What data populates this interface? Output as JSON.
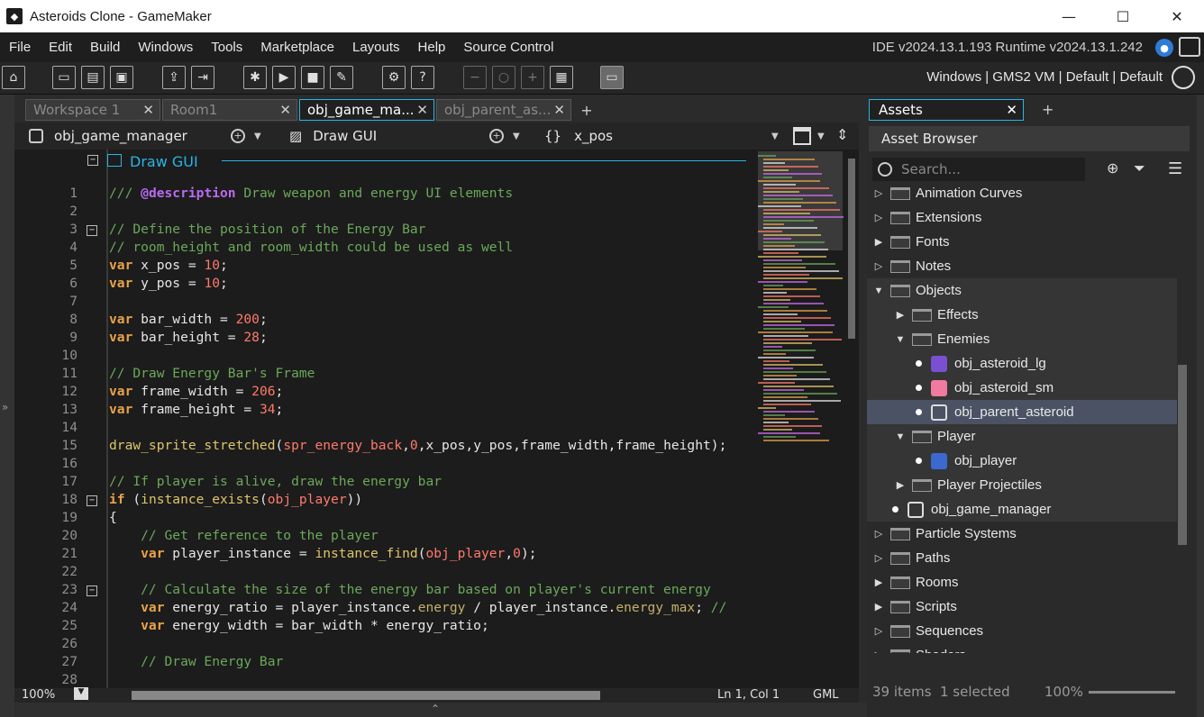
{
  "window": {
    "title": "Asteroids Clone - GameMaker",
    "minimize": "—",
    "maximize": "☐",
    "close": "✕"
  },
  "menu": {
    "items": [
      "File",
      "Edit",
      "Build",
      "Windows",
      "Tools",
      "Marketplace",
      "Layouts",
      "Help",
      "Source Control"
    ],
    "version": "IDE v2024.13.1.193  Runtime v2024.13.1.242"
  },
  "toolbar": {
    "target": "Windows | GMS2 VM | Default | Default"
  },
  "tabs": [
    {
      "label": "Workspace 1",
      "active": false
    },
    {
      "label": "Room1",
      "active": false
    },
    {
      "label": "obj_game_ma...",
      "active": true
    },
    {
      "label": "obj_parent_as...",
      "active": false
    }
  ],
  "event_bar": {
    "object": "obj_game_manager",
    "event": "Draw GUI",
    "symbol": "x_pos"
  },
  "editor": {
    "region_header": "Draw GUI",
    "lines": [
      {
        "n": "1",
        "tokens": [
          [
            "c-cmt",
            "/// "
          ],
          [
            "c-tag",
            "@description"
          ],
          [
            "c-cmt",
            " Draw weapon and energy UI elements"
          ]
        ]
      },
      {
        "n": "2",
        "tokens": []
      },
      {
        "n": "3",
        "tokens": [
          [
            "c-cmt",
            "// Define the position of the Energy Bar"
          ]
        ]
      },
      {
        "n": "4",
        "tokens": [
          [
            "c-cmt",
            "// room_height and room_width could be used as well"
          ]
        ]
      },
      {
        "n": "5",
        "tokens": [
          [
            "c-kw",
            "var"
          ],
          [
            "c-plain",
            " x_pos = "
          ],
          [
            "c-num",
            "10"
          ],
          [
            "c-plain",
            ";"
          ]
        ]
      },
      {
        "n": "6",
        "tokens": [
          [
            "c-kw",
            "var"
          ],
          [
            "c-plain",
            " y_pos = "
          ],
          [
            "c-num",
            "10"
          ],
          [
            "c-plain",
            ";"
          ]
        ]
      },
      {
        "n": "7",
        "tokens": []
      },
      {
        "n": "8",
        "tokens": [
          [
            "c-kw",
            "var"
          ],
          [
            "c-plain",
            " bar_width = "
          ],
          [
            "c-num",
            "200"
          ],
          [
            "c-plain",
            ";"
          ]
        ]
      },
      {
        "n": "9",
        "tokens": [
          [
            "c-kw",
            "var"
          ],
          [
            "c-plain",
            " bar_height = "
          ],
          [
            "c-num",
            "28"
          ],
          [
            "c-plain",
            ";"
          ]
        ]
      },
      {
        "n": "10",
        "tokens": []
      },
      {
        "n": "11",
        "tokens": [
          [
            "c-cmt",
            "// Draw Energy Bar's Frame"
          ]
        ]
      },
      {
        "n": "12",
        "tokens": [
          [
            "c-kw",
            "var"
          ],
          [
            "c-plain",
            " frame_width = "
          ],
          [
            "c-num",
            "206"
          ],
          [
            "c-plain",
            ";"
          ]
        ]
      },
      {
        "n": "13",
        "tokens": [
          [
            "c-kw",
            "var"
          ],
          [
            "c-plain",
            " frame_height = "
          ],
          [
            "c-num",
            "34"
          ],
          [
            "c-plain",
            ";"
          ]
        ]
      },
      {
        "n": "14",
        "tokens": []
      },
      {
        "n": "15",
        "tokens": [
          [
            "c-fn",
            "draw_sprite_stretched"
          ],
          [
            "c-plain",
            "("
          ],
          [
            "c-num",
            "spr_energy_back"
          ],
          [
            "c-plain",
            ","
          ],
          [
            "c-num",
            "0"
          ],
          [
            "c-plain",
            ",x_pos,y_pos,frame_width,frame_height);"
          ]
        ]
      },
      {
        "n": "16",
        "tokens": []
      },
      {
        "n": "17",
        "tokens": [
          [
            "c-cmt",
            "// If player is alive, draw the energy bar"
          ]
        ]
      },
      {
        "n": "18",
        "tokens": [
          [
            "c-kw",
            "if"
          ],
          [
            "c-plain",
            " ("
          ],
          [
            "c-fn",
            "instance_exists"
          ],
          [
            "c-plain",
            "("
          ],
          [
            "c-num",
            "obj_player"
          ],
          [
            "c-plain",
            "))"
          ]
        ]
      },
      {
        "n": "19",
        "tokens": [
          [
            "c-plain",
            "{"
          ]
        ]
      },
      {
        "n": "20",
        "tokens": [
          [
            "c-cmt",
            "    // Get reference to the player"
          ]
        ]
      },
      {
        "n": "21",
        "tokens": [
          [
            "c-kw",
            "    var"
          ],
          [
            "c-plain",
            " player_instance = "
          ],
          [
            "c-fn",
            "instance_find"
          ],
          [
            "c-plain",
            "("
          ],
          [
            "c-num",
            "obj_player"
          ],
          [
            "c-plain",
            ","
          ],
          [
            "c-num",
            "0"
          ],
          [
            "c-plain",
            ");"
          ]
        ]
      },
      {
        "n": "22",
        "tokens": []
      },
      {
        "n": "23",
        "tokens": [
          [
            "c-cmt",
            "    // Calculate the size of the energy bar based on player's current energy"
          ]
        ]
      },
      {
        "n": "24",
        "tokens": [
          [
            "c-kw",
            "    var"
          ],
          [
            "c-plain",
            " energy_ratio = player_instance."
          ],
          [
            "c-var",
            "energy"
          ],
          [
            "c-plain",
            " / player_instance."
          ],
          [
            "c-var",
            "energy_max"
          ],
          [
            "c-plain",
            "; "
          ],
          [
            "c-cmt",
            "//"
          ]
        ]
      },
      {
        "n": "25",
        "tokens": [
          [
            "c-kw",
            "    var"
          ],
          [
            "c-plain",
            " energy_width = bar_width * energy_ratio;"
          ]
        ]
      },
      {
        "n": "26",
        "tokens": []
      },
      {
        "n": "27",
        "tokens": [
          [
            "c-cmt",
            "    // Draw Energy Bar"
          ]
        ]
      },
      {
        "n": "28",
        "tokens": []
      }
    ]
  },
  "status": {
    "zoom": "100%",
    "position": "Ln 1, Col 1",
    "language": "GML"
  },
  "assets": {
    "tab_label": "Assets",
    "browser_label": "Asset Browser",
    "search_placeholder": "Search...",
    "tree": [
      {
        "label": "Animation Curves",
        "level": 0,
        "type": "folder",
        "arrow": "▷"
      },
      {
        "label": "Extensions",
        "level": 0,
        "type": "folder",
        "arrow": "▷"
      },
      {
        "label": "Fonts",
        "level": 0,
        "type": "folder",
        "arrow": "▶"
      },
      {
        "label": "Notes",
        "level": 0,
        "type": "folder",
        "arrow": "▷"
      },
      {
        "label": "Objects",
        "level": 0,
        "type": "folder",
        "arrow": "▼"
      },
      {
        "label": "Effects",
        "level": 1,
        "type": "folder",
        "arrow": "▶"
      },
      {
        "label": "Enemies",
        "level": 1,
        "type": "folder",
        "arrow": "▼"
      },
      {
        "label": "obj_asteroid_lg",
        "level": 2,
        "type": "object",
        "sprite": "#7a4fd0"
      },
      {
        "label": "obj_asteroid_sm",
        "level": 2,
        "type": "object",
        "sprite": "#f07aa0"
      },
      {
        "label": "obj_parent_asteroid",
        "level": 2,
        "type": "object",
        "sprite": "none",
        "selected": true
      },
      {
        "label": "Player",
        "level": 1,
        "type": "folder",
        "arrow": "▼"
      },
      {
        "label": "obj_player",
        "level": 2,
        "type": "object",
        "sprite": "#3a6ad0"
      },
      {
        "label": "Player Projectiles",
        "level": 1,
        "type": "folder",
        "arrow": "▶"
      },
      {
        "label": "obj_game_manager",
        "level": 1,
        "type": "object",
        "sprite": "none"
      },
      {
        "label": "Particle Systems",
        "level": 0,
        "type": "folder",
        "arrow": "▷"
      },
      {
        "label": "Paths",
        "level": 0,
        "type": "folder",
        "arrow": "▷"
      },
      {
        "label": "Rooms",
        "level": 0,
        "type": "folder",
        "arrow": "▶"
      },
      {
        "label": "Scripts",
        "level": 0,
        "type": "folder",
        "arrow": "▶"
      },
      {
        "label": "Sequences",
        "level": 0,
        "type": "folder",
        "arrow": "▷"
      },
      {
        "label": "Shaders",
        "level": 0,
        "type": "folder",
        "arrow": "▷"
      }
    ],
    "footer": {
      "count": "39 items",
      "selected": "1 selected",
      "zoom": "100%"
    }
  }
}
